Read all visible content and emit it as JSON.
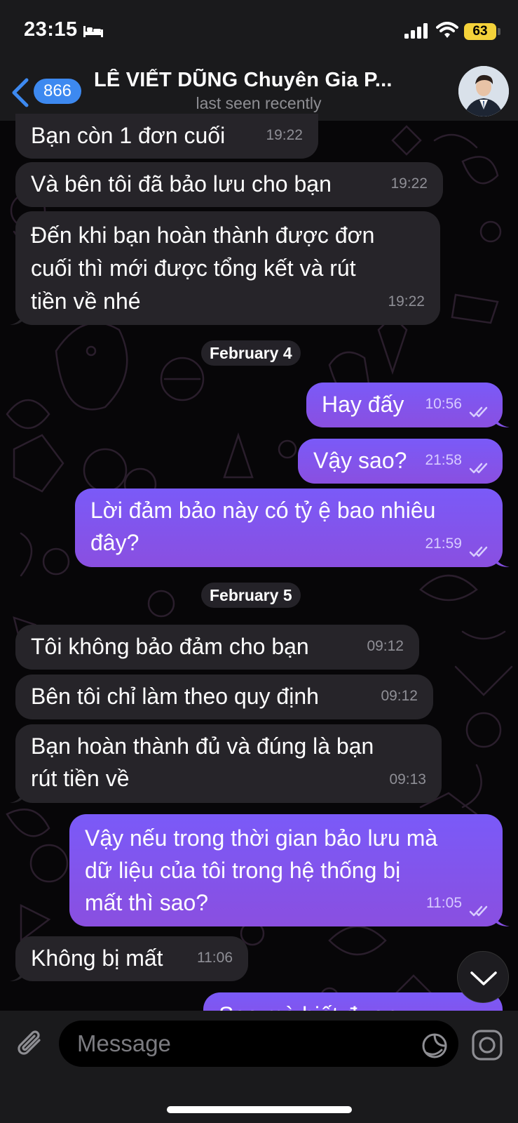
{
  "status_bar": {
    "time": "23:15",
    "battery": "63",
    "icons": [
      "bed-icon",
      "signal-icon",
      "wifi-icon",
      "battery-icon"
    ]
  },
  "header": {
    "back_icon": "chevron-left-icon",
    "unread_count": "866",
    "title": "LÊ VIẾT DŨNG Chuyên Gia P...",
    "subtitle": "last seen recently",
    "accent_color": "#3d89f0"
  },
  "messages": [
    {
      "text": "Bạn còn 1 đơn cuối",
      "time": "19:22",
      "direction": "in"
    },
    {
      "text": "Và bên tôi đã bảo lưu cho bạn",
      "time": "19:22",
      "direction": "in"
    },
    {
      "text_lines": [
        "Đến khi bạn hoàn thành được đơn",
        "cuối thì mới được tổng kết  và rút",
        "tiền về nhé"
      ],
      "time": "19:22",
      "direction": "in"
    },
    {
      "date": "February 4"
    },
    {
      "text": "Hay đấy",
      "time": "10:56",
      "direction": "out",
      "read": true
    },
    {
      "text": "Vậy sao?",
      "time": "21:58",
      "direction": "out",
      "read": true
    },
    {
      "text_lines": [
        "Lời đảm bảo này có tỷ ệ bao nhiêu",
        "đây?"
      ],
      "time": "21:59",
      "direction": "out",
      "read": true
    },
    {
      "date": "February 5"
    },
    {
      "text": "Tôi không bảo đảm cho bạn",
      "time": "09:12",
      "direction": "in"
    },
    {
      "text": "Bên tôi chỉ làm theo quy định",
      "time": "09:12",
      "direction": "in"
    },
    {
      "text_lines": [
        "Bạn hoàn thành đủ và đúng là bạn",
        "rút tiền về"
      ],
      "time": "09:13",
      "direction": "in"
    },
    {
      "text_lines": [
        "Vậy nếu trong thời gian bảo lưu mà",
        "dữ liệu của tôi trong hệ thống bị",
        "mất thì sao?"
      ],
      "time": "11:05",
      "direction": "out",
      "read": true
    },
    {
      "text": "Không bị mất",
      "time": "11:06",
      "direction": "in"
    },
    {
      "text": "Sao mà biết được",
      "direction": "out",
      "partially_visible": true
    }
  ],
  "input": {
    "placeholder": "Message",
    "icons": [
      "paperclip-icon",
      "sticker-icon",
      "camera-icon"
    ]
  },
  "colors": {
    "incoming_bubble": "#262429",
    "outgoing_bubble": "#7a5af8",
    "background": "#070608"
  }
}
